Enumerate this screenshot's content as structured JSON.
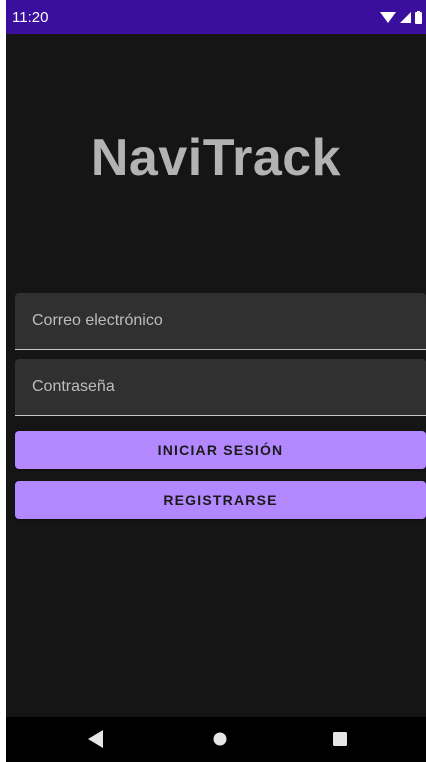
{
  "status_bar": {
    "time": "11:20",
    "icons": [
      "wifi-icon",
      "signal-icon",
      "battery-icon"
    ]
  },
  "app": {
    "title": "NaviTrack"
  },
  "form": {
    "email_placeholder": "Correo electrónico",
    "password_placeholder": "Contraseña",
    "login_label": "INICIAR SESIÓN",
    "register_label": "REGISTRARSE"
  },
  "nav_bar": {
    "icons": [
      "back-icon",
      "home-icon",
      "recents-icon"
    ]
  },
  "colors": {
    "status_bar": "#3a0f9e",
    "background": "#151515",
    "button": "#b388ff",
    "title": "#b3b3b3",
    "field": "#303030"
  }
}
